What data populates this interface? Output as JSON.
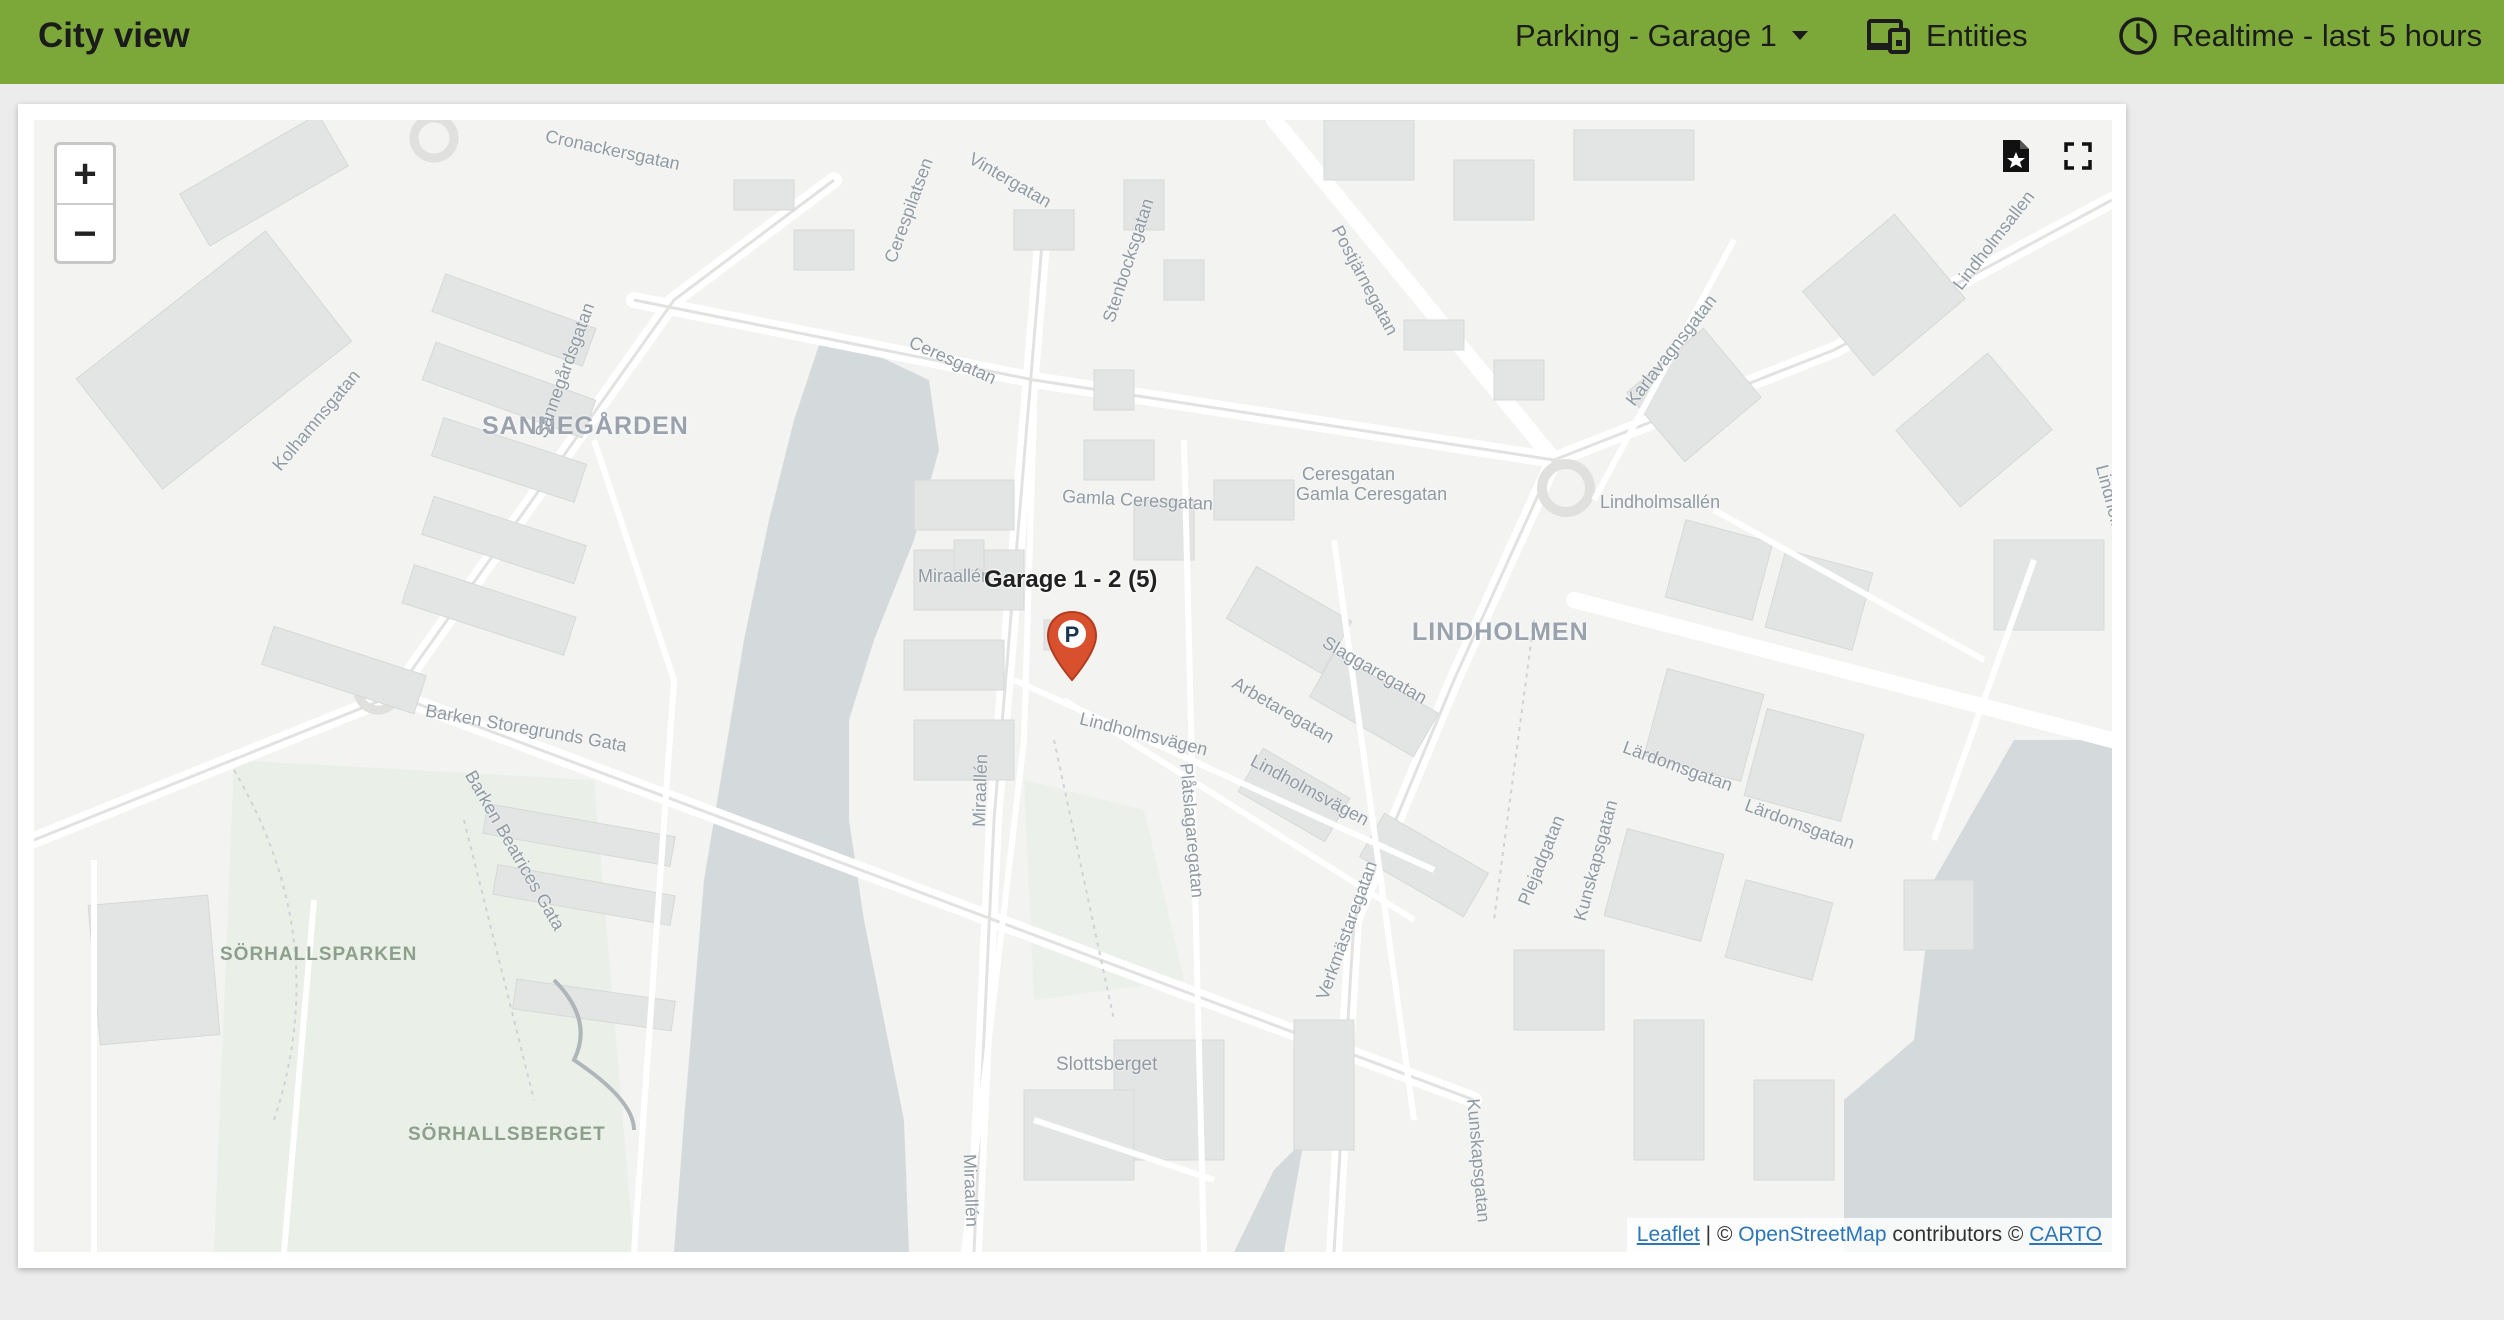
{
  "header": {
    "title": "City view",
    "view_selector": "Parking - Garage 1",
    "entities_label": "Entities",
    "time_range_label": "Realtime - last 5 hours"
  },
  "map": {
    "marker_label": "Garage 1 - 2 (5)",
    "marker_icon": "parking-pin-icon",
    "marker_glyph": "P",
    "zoom_in": "+",
    "zoom_out": "−",
    "attribution": {
      "leaflet": "Leaflet",
      "separator": " | © ",
      "osm": "OpenStreetMap",
      "contributors": " contributors © ",
      "carto": "CARTO"
    },
    "districts": [
      "SANNEGÅRDEN",
      "LINDHOLMEN"
    ],
    "parks": [
      "SÖRHALLSPARKEN",
      "SÖRHALLSBERGET"
    ],
    "area_label": "Slottsberget",
    "streets": [
      "Cronackersgatan",
      "Vintergatan",
      "Cerespilatsen",
      "Stenbocksgatan",
      "Postjärnegatan",
      "Ceresgatan",
      "Sannegårdsgatan",
      "Kolhamnsgatan",
      "Gamla Ceresgatan",
      "Ceresgatan",
      "Gamla Ceresgatan",
      "Lindholmsallén",
      "Karlavagnsgatan",
      "Lindholmsallen",
      "Miraallén",
      "Slaggaregatan",
      "Arbetaregatan",
      "Lindholmsvägen",
      "Lindholmsvägen",
      "Barken Storegrunds Gata",
      "Barken Beatrices Gata",
      "Plåtslagaregatan",
      "Miraallén",
      "Verkmästaregatan",
      "Plejadgatan",
      "Kunskapsgatan",
      "Lärdomsgatan",
      "Lärdomsgatan",
      "Kunskapsgatan",
      "Miraallén",
      "Lindholm"
    ]
  },
  "colors": {
    "header_bg": "#7ca83a",
    "marker": "#d9502f",
    "water": "#d4dadc"
  }
}
